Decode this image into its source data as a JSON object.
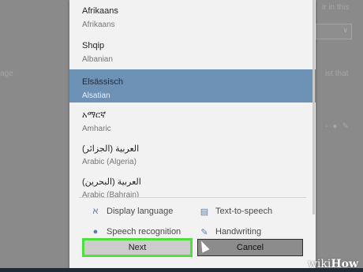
{
  "background": {
    "left_text": "age",
    "right_texts": [
      "ir in this",
      "ist that"
    ]
  },
  "language_list": [
    {
      "native": "Afrikaans",
      "english": "Afrikaans",
      "selected": false
    },
    {
      "native": "Shqip",
      "english": "Albanian",
      "selected": false
    },
    {
      "native": "Elsässisch",
      "english": "Alsatian",
      "selected": true
    },
    {
      "native": "አማርኛ",
      "english": "Amharic",
      "selected": false
    },
    {
      "native": "(العربية (الجزائر",
      "english": "Arabic (Algeria)",
      "selected": false
    },
    {
      "native": "(العربية (البحرين",
      "english": "Arabic (Bahrain)",
      "selected": false
    }
  ],
  "features": {
    "display_language": "Display language",
    "text_to_speech": "Text-to-speech",
    "speech_recognition": "Speech recognition",
    "handwriting": "Handwriting"
  },
  "buttons": {
    "next": "Next",
    "cancel": "Cancel"
  },
  "watermark": {
    "part1": "wiki",
    "part2": "How"
  },
  "colors": {
    "selected_row": "#6e91b6",
    "highlight_border": "#4fe03f"
  }
}
